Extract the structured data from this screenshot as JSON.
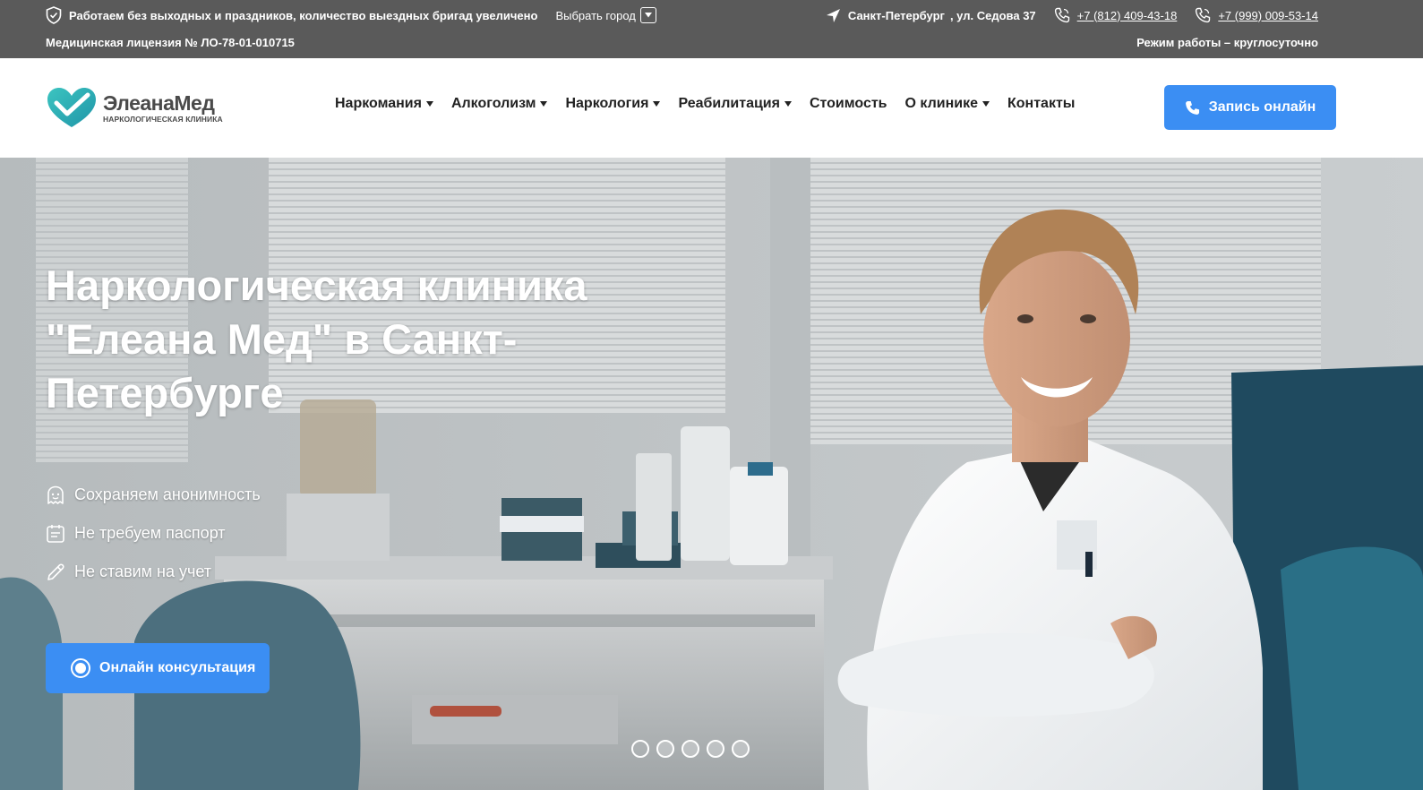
{
  "topbar": {
    "notice": "Работаем без выходных и праздников, количество выездных бригад увеличено",
    "city_select_label": "Выбрать город",
    "license": "Медицинская лицензия № ЛО-78-01-010715",
    "city": "Санкт-Петербург",
    "address": ", ул. Седова 37",
    "phone_1": "+7 (812) 409-43-18",
    "phone_2": "+7 (999) 009-53-14",
    "hours": "Режим работы – круглосуточно"
  },
  "header": {
    "logo_name": "ЭлеанаМед",
    "logo_subtitle": "Наркологическая клиника",
    "nav": [
      {
        "label": "Наркомания",
        "has_dropdown": true
      },
      {
        "label": "Алкоголизм",
        "has_dropdown": true
      },
      {
        "label": "Наркология",
        "has_dropdown": true
      },
      {
        "label": "Реабилитация",
        "has_dropdown": true
      },
      {
        "label": "Стоимость",
        "has_dropdown": false
      },
      {
        "label": "О клинике",
        "has_dropdown": true
      },
      {
        "label": "Контакты",
        "has_dropdown": false
      }
    ],
    "cta_label": "Запись онлайн"
  },
  "hero": {
    "title": "Наркологическая клиника \"Елеана Мед\" в Санкт-Петербурге",
    "features": [
      {
        "label": "Сохраняем анонимность",
        "icon": "anonymous-icon"
      },
      {
        "label": "Не требуем паспорт",
        "icon": "passport-icon"
      },
      {
        "label": "Не ставим на учет",
        "icon": "pencil-icon"
      }
    ],
    "consult_label": "Онлайн консультация",
    "slides_total": 5,
    "slide_active": 1
  },
  "colors": {
    "topbar_bg": "#5a5a5a",
    "accent_blue": "#3b8ef3",
    "logo_teal": "#2bb3b8"
  }
}
